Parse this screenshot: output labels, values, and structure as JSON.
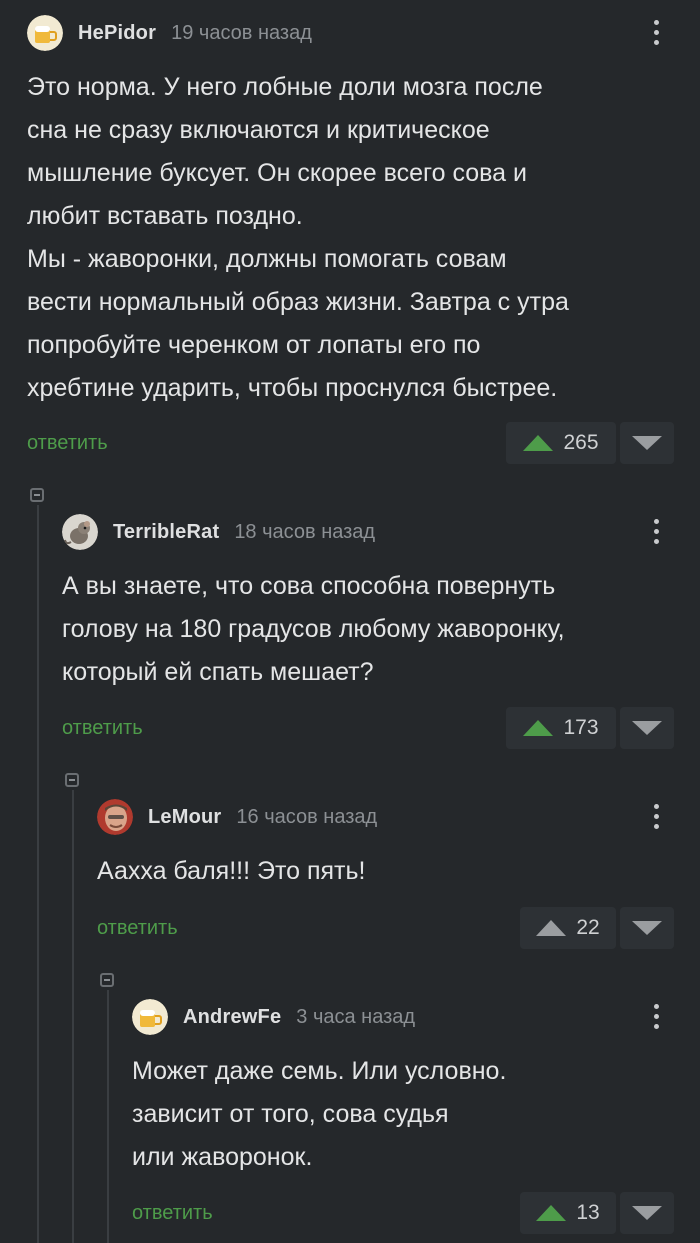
{
  "colors": {
    "background": "#25282b",
    "accent": "#4e9c4a",
    "muted": "#8c9094"
  },
  "comments": [
    {
      "user": "HePidor",
      "time": "19 часов назад",
      "text": "Это норма. У него лобные доли мозга после\nсна не сразу включаются и критическое\nмышление буксует. Он скорее всего сова и\nлюбит вставать поздно.\nМы - жаворонки, должны помогать совам\nвести нормальный образ жизни. Завтра с утра\nпопробуйте черенком от лопаты его по\nхребтине ударить, чтобы проснулся быстрее.",
      "reply_label": "ответить",
      "votes": "265",
      "upvote_active": true,
      "avatar_icon": "beer-mug-avatar"
    },
    {
      "user": "TerribleRat",
      "time": "18 часов назад",
      "text": "А вы знаете, что сова способна повернуть\nголову на 180 градусов любому жаворонку,\nкоторый ей спать мешает?",
      "reply_label": "ответить",
      "votes": "173",
      "upvote_active": true,
      "avatar_icon": "rat-avatar"
    },
    {
      "user": "LeMour",
      "time": "16 часов назад",
      "text": "Аахха баля!!! Это пять!",
      "reply_label": "ответить",
      "votes": "22",
      "upvote_active": false,
      "avatar_icon": "person-photo-avatar"
    },
    {
      "user": "AndrewFe",
      "time": "3 часа назад",
      "text": "Может даже семь. Или условно.\nзависит от того, сова судья\nили жаворонок.",
      "reply_label": "ответить",
      "votes": "13",
      "upvote_active": true,
      "avatar_icon": "beer-mug-avatar"
    }
  ]
}
